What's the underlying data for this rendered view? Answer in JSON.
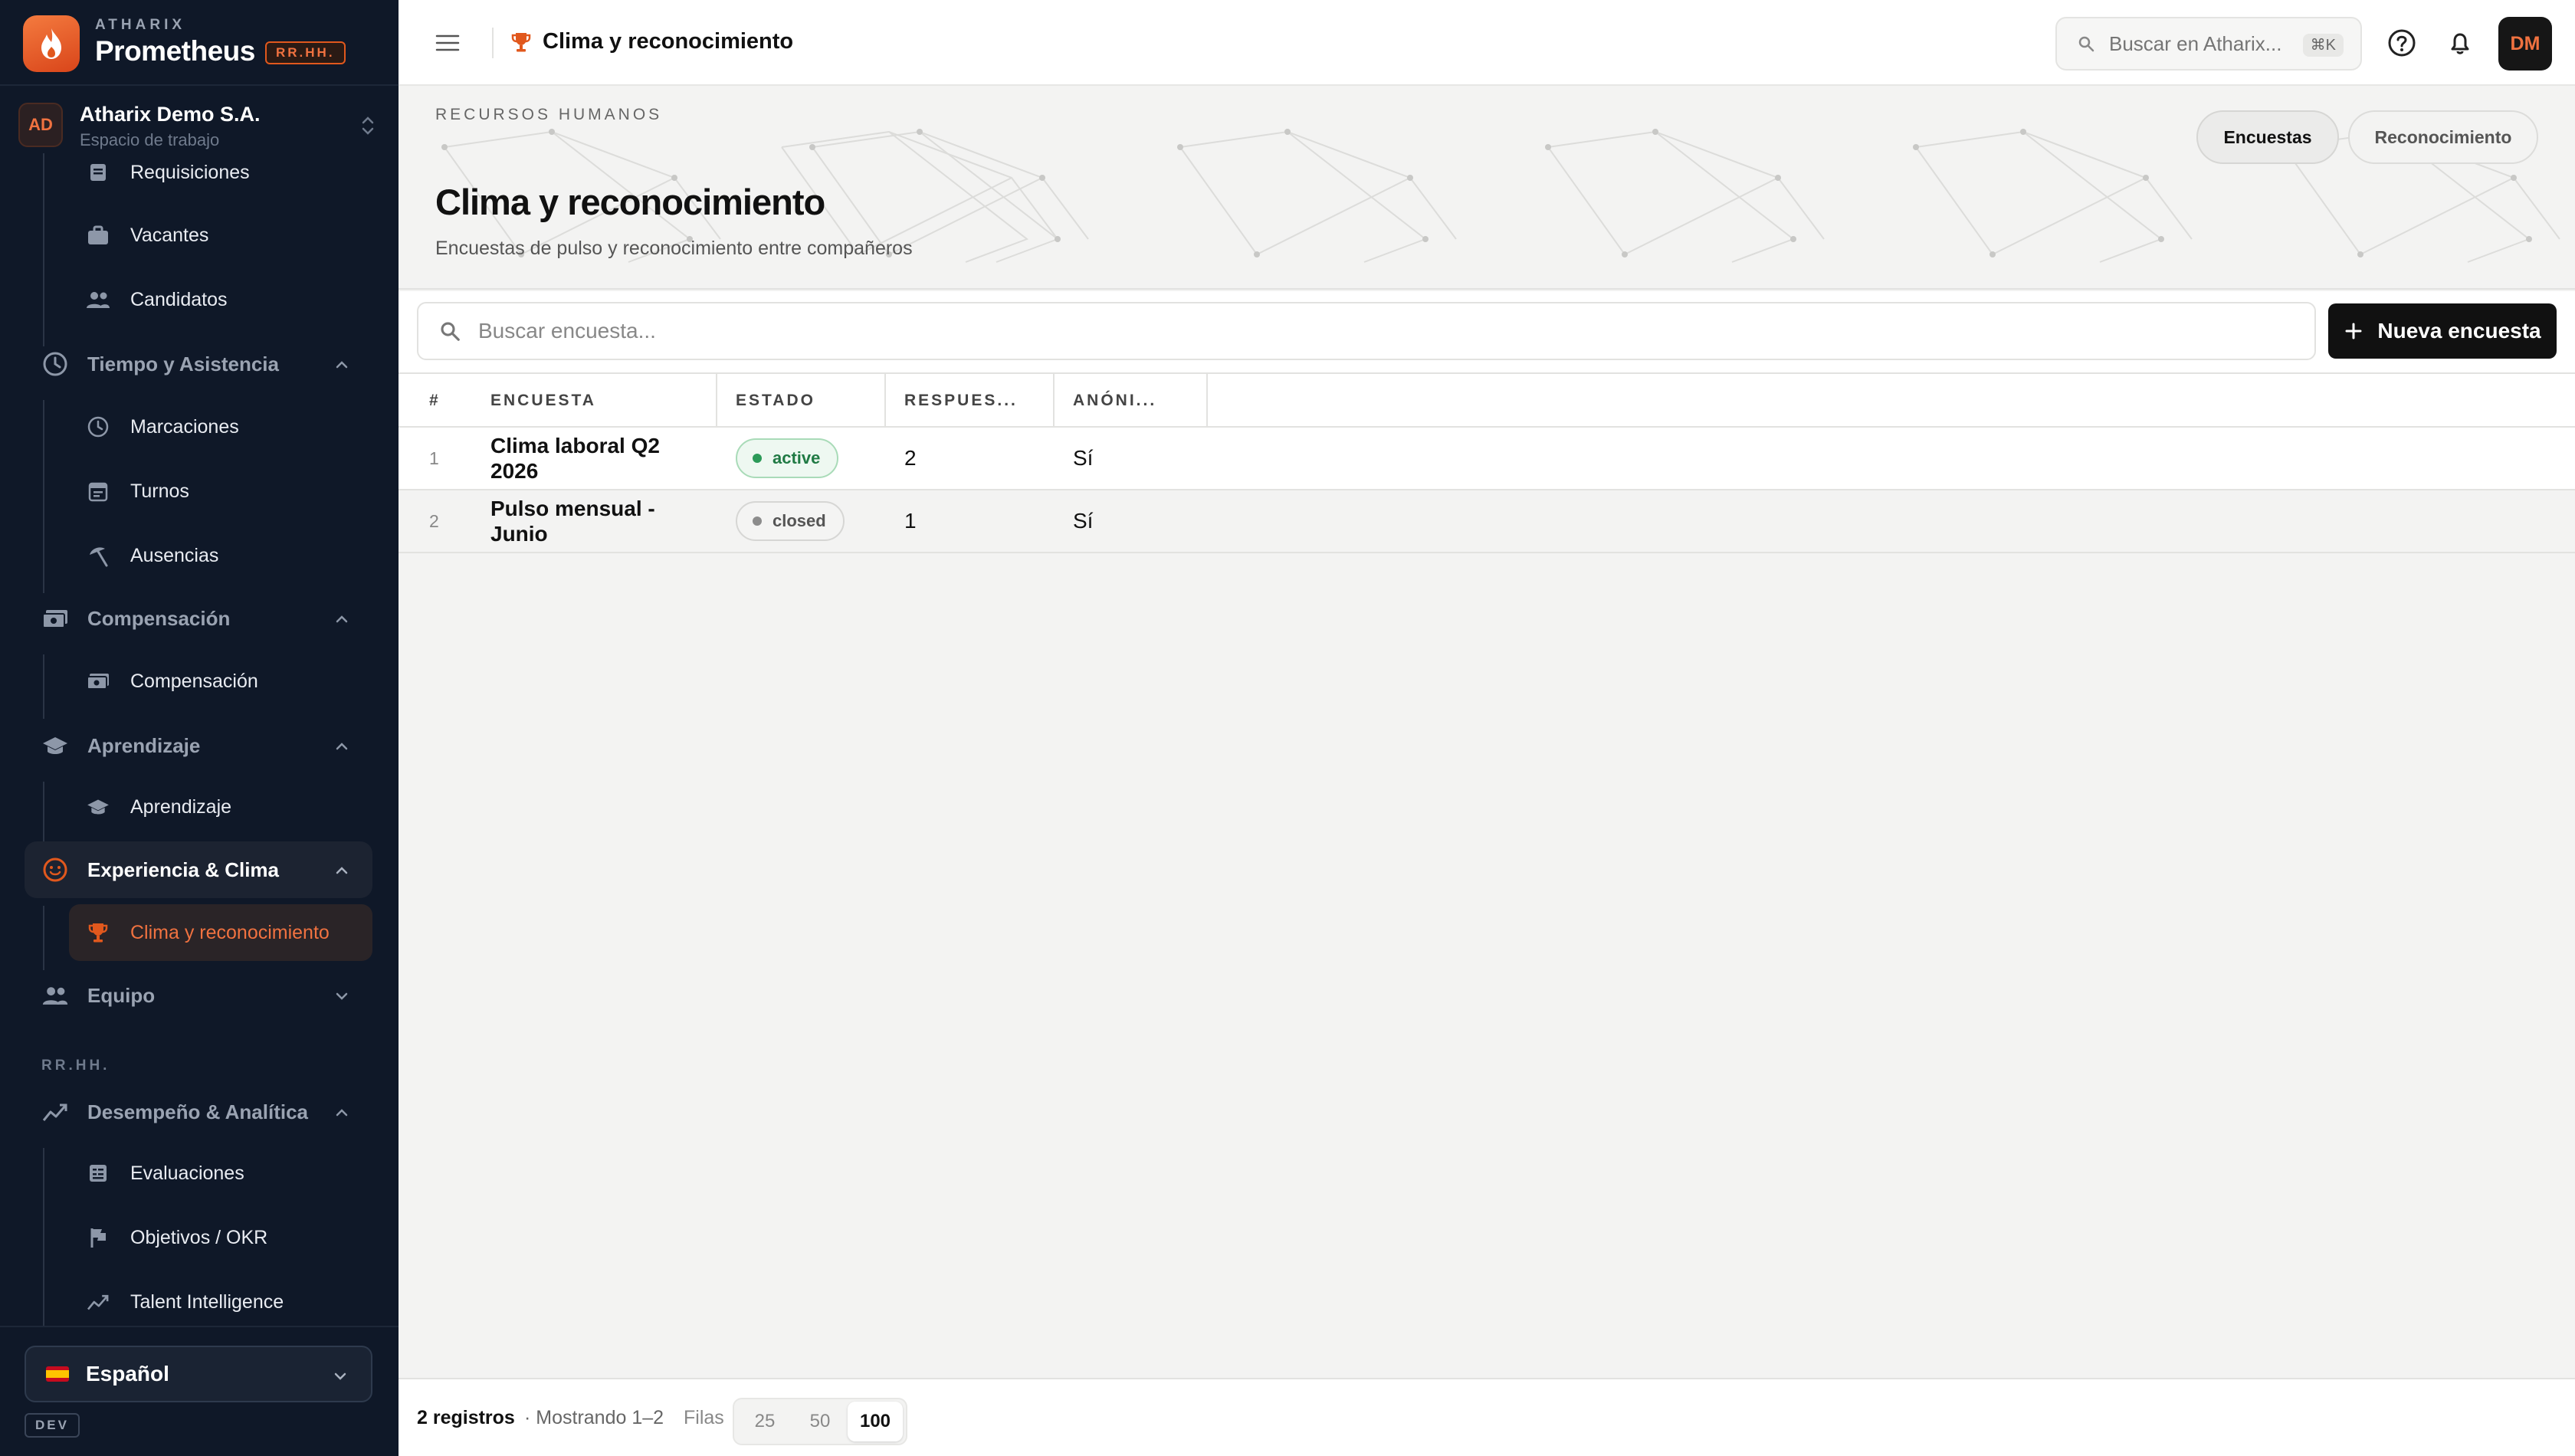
{
  "brand": {
    "small": "ATHARIX",
    "name": "Prometheus",
    "badge": "RR.HH."
  },
  "org": {
    "initials": "AD",
    "name": "Atharix Demo S.A.",
    "sub": "Espacio de trabajo"
  },
  "nav": {
    "requisiciones": "Requisiciones",
    "vacantes": "Vacantes",
    "candidatos": "Candidatos",
    "tiempo": "Tiempo y Asistencia",
    "marcaciones": "Marcaciones",
    "turnos": "Turnos",
    "ausencias": "Ausencias",
    "compensacion_group": "Compensación",
    "compensacion": "Compensación",
    "aprendizaje_group": "Aprendizaje",
    "aprendizaje": "Aprendizaje",
    "experiencia": "Experiencia & Clima",
    "clima": "Clima y reconocimiento",
    "equipo": "Equipo",
    "section_rrhh": "RR.HH.",
    "desempeno": "Desempeño & Analítica",
    "evaluaciones": "Evaluaciones",
    "objetivos": "Objetivos / OKR",
    "talent": "Talent Intelligence"
  },
  "language": "Español",
  "env_badge": "DEV",
  "topbar": {
    "breadcrumb": "Clima y reconocimiento",
    "search_placeholder": "Buscar en Atharix...",
    "shortcut": "⌘K",
    "user_initials": "DM"
  },
  "header": {
    "eyebrow": "RECURSOS HUMANOS",
    "title": "Clima y reconocimiento",
    "subtitle": "Encuestas de pulso y reconocimiento entre compañeros",
    "tabs": [
      "Encuestas",
      "Reconocimiento"
    ]
  },
  "toolbar": {
    "search_placeholder": "Buscar encuesta...",
    "new_button": "Nueva encuesta"
  },
  "table": {
    "columns": [
      "#",
      "ENCUESTA",
      "ESTADO",
      "RESPUES...",
      "ANÓNI..."
    ],
    "rows": [
      {
        "num": "1",
        "title": "Clima laboral Q2 2026",
        "status": "active",
        "responses": "2",
        "anonymous": "Sí"
      },
      {
        "num": "2",
        "title": "Pulso mensual - Junio",
        "status": "closed",
        "responses": "1",
        "anonymous": "Sí"
      }
    ]
  },
  "footer": {
    "count": "2 registros",
    "showing": "· Mostrando 1–2",
    "rows_label": "Filas",
    "page_sizes": [
      "25",
      "50",
      "100"
    ],
    "selected_page_size": "100"
  },
  "colors": {
    "accent": "#e1581d",
    "sidebar_bg": "#0f1828",
    "active_green": "#2c9a58"
  }
}
